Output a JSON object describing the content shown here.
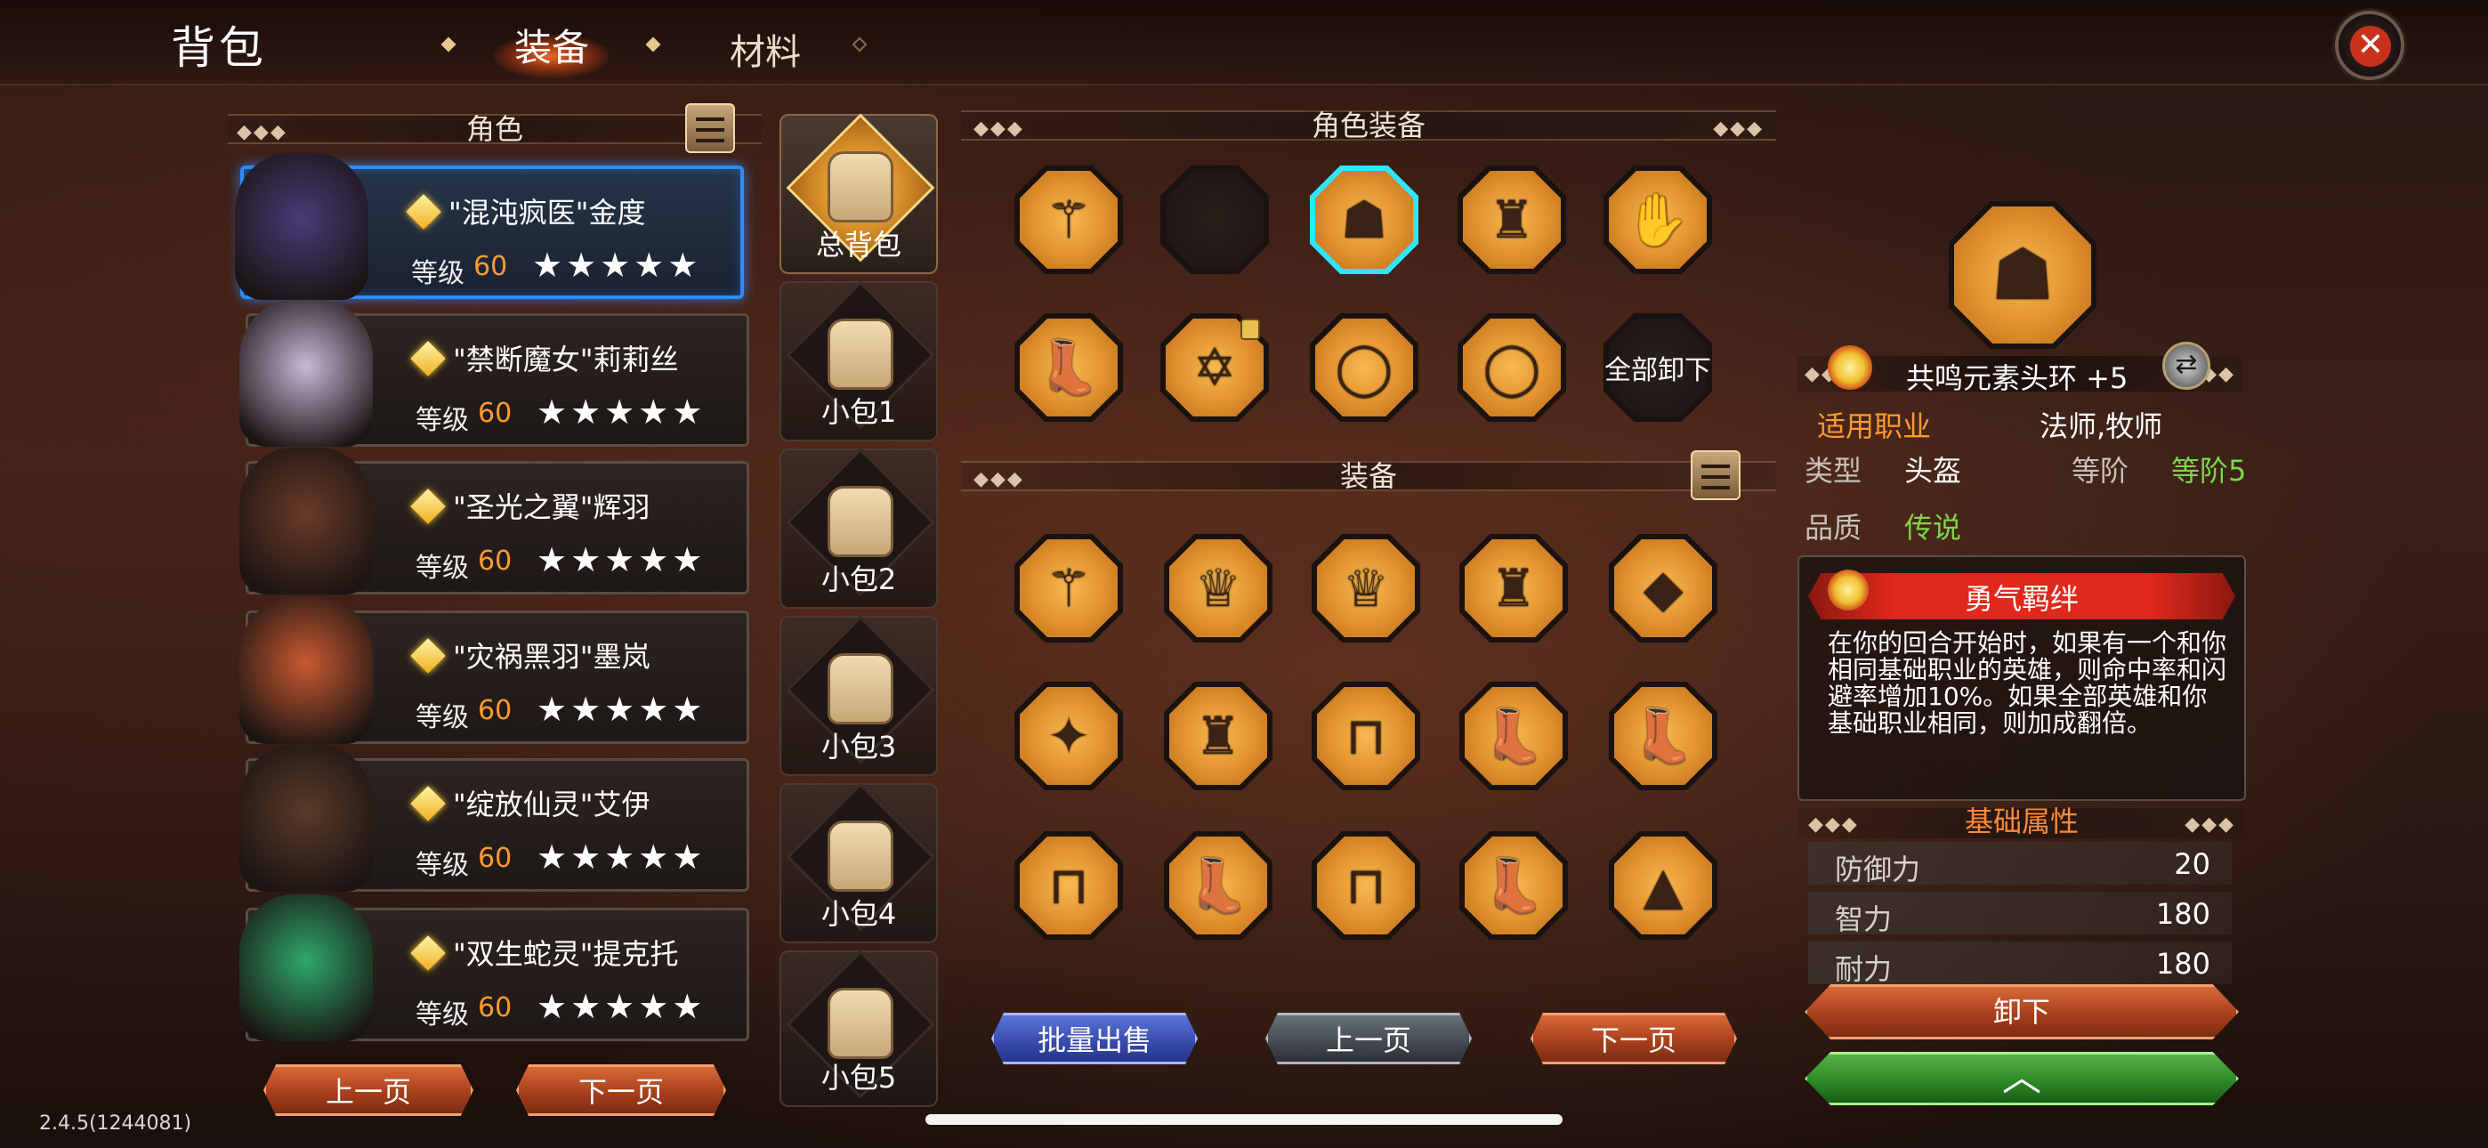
{
  "header": {
    "title": "背包",
    "tabs": [
      {
        "label": "装备",
        "active": true
      },
      {
        "label": "材料",
        "active": false
      }
    ]
  },
  "characters_panel": {
    "title": "角色",
    "characters": [
      {
        "name": "\"混沌疯医\"金度",
        "level_label": "等级",
        "level": "60",
        "stars": "★★★★★",
        "selected": true,
        "color": "#4a3a78"
      },
      {
        "name": "\"禁断魔女\"莉莉丝",
        "level_label": "等级",
        "level": "60",
        "stars": "★★★★★",
        "selected": false,
        "color": "#c8b8d8"
      },
      {
        "name": "\"圣光之翼\"辉羽",
        "level_label": "等级",
        "level": "60",
        "stars": "★★★★★",
        "selected": false,
        "color": "#6a3a28"
      },
      {
        "name": "\"灾祸黑羽\"墨岚",
        "level_label": "等级",
        "level": "60",
        "stars": "★★★★★",
        "selected": false,
        "color": "#c85a30"
      },
      {
        "name": "\"绽放仙灵\"艾伊",
        "level_label": "等级",
        "level": "60",
        "stars": "★★★★★",
        "selected": false,
        "color": "#5a3a28"
      },
      {
        "name": "\"双生蛇灵\"提克托",
        "level_label": "等级",
        "level": "60",
        "stars": "★★★★★",
        "selected": false,
        "color": "#2ea86a"
      }
    ],
    "prev_label": "上一页",
    "next_label": "下一页"
  },
  "bags": [
    {
      "label": "总背包",
      "selected": true
    },
    {
      "label": "小包1",
      "selected": false
    },
    {
      "label": "小包2",
      "selected": false
    },
    {
      "label": "小包3",
      "selected": false
    },
    {
      "label": "小包4",
      "selected": false
    },
    {
      "label": "小包5",
      "selected": false
    }
  ],
  "character_equipment": {
    "title": "角色装备",
    "unequip_all_label": "全部卸下",
    "slots": [
      {
        "icon": "staff-icon",
        "glyph": "⚚"
      },
      {
        "icon": "empty-slot",
        "glyph": ""
      },
      {
        "icon": "hood-icon",
        "glyph": "☗",
        "selected": true
      },
      {
        "icon": "robe-icon",
        "glyph": "♜"
      },
      {
        "icon": "gloves-icon",
        "glyph": "✋"
      },
      {
        "icon": "boots-icon",
        "glyph": "👢"
      },
      {
        "icon": "hexagram-icon",
        "glyph": "✡",
        "locked": true
      },
      {
        "icon": "green-ring-icon",
        "glyph": "◯"
      },
      {
        "icon": "red-ring-icon",
        "glyph": "◯"
      }
    ]
  },
  "equipment": {
    "title": "装备",
    "items": [
      {
        "icon": "crystal-staff-icon",
        "glyph": "⚚"
      },
      {
        "icon": "circlet-icon",
        "glyph": "♕"
      },
      {
        "icon": "circlet-icon",
        "glyph": "♕"
      },
      {
        "icon": "blue-cloak-icon",
        "glyph": "♜"
      },
      {
        "icon": "sapphire-necklace-icon",
        "glyph": "◆"
      },
      {
        "icon": "ice-star-icon",
        "glyph": "✦"
      },
      {
        "icon": "dark-coat-icon",
        "glyph": "♜"
      },
      {
        "icon": "dark-greaves-icon",
        "glyph": "⊓"
      },
      {
        "icon": "green-boots-icon",
        "glyph": "👢"
      },
      {
        "icon": "brown-boots-icon",
        "glyph": "👢"
      },
      {
        "icon": "purple-gauntlets-icon",
        "glyph": "⊓"
      },
      {
        "icon": "blue-boots-icon",
        "glyph": "👢"
      },
      {
        "icon": "purple-greaves-icon",
        "glyph": "⊓"
      },
      {
        "icon": "purple-boots-icon",
        "glyph": "👢"
      },
      {
        "icon": "dark-dress-icon",
        "glyph": "▲"
      }
    ]
  },
  "bottom_buttons": {
    "bulk_sell": "批量出售",
    "prev": "上一页",
    "next": "下一页"
  },
  "detail": {
    "item_name": "共鸣元素头环 +5",
    "applicable_label": "适用职业",
    "applicable_value": "法师,牧师",
    "type_label": "类型",
    "type_value": "头盔",
    "tier_label": "等阶",
    "tier_value": "等阶5",
    "quality_label": "品质",
    "quality_value": "传说",
    "skill": {
      "title": "勇气羁绊",
      "description": "在你的回合开始时，如果有一个和你相同基础职业的英雄，则命中率和闪避率增加10%。如果全部英雄和你基础职业相同，则加成翻倍。"
    },
    "base_attributes_title": "基础属性",
    "stats": [
      {
        "name": "防御力",
        "value": "20"
      },
      {
        "name": "智力",
        "value": "180"
      },
      {
        "name": "耐力",
        "value": "180"
      }
    ],
    "unequip_label": "卸下"
  },
  "version": "2.4.5(1244081)",
  "colors": {
    "accent_orange": "#ff9b2e",
    "legend_green": "#7cd64a",
    "tier_green": "#7cd64a",
    "select_blue": "#2d8cff",
    "select_cyan": "#2ee6ff"
  }
}
